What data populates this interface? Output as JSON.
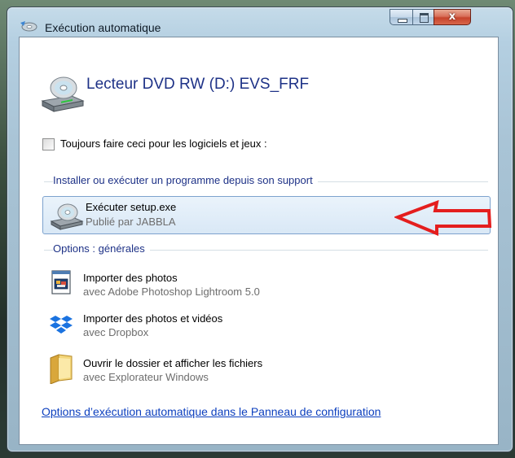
{
  "window": {
    "title": "Exécution automatique",
    "close_glyph": "x"
  },
  "device": {
    "title": "Lecteur DVD RW (D:) EVS_FRF",
    "icon": "dvd-drive-icon"
  },
  "always_option": {
    "label": "Toujours faire ceci pour les logiciels et jeux :",
    "checked": false
  },
  "groups": [
    {
      "header": "Installer ou exécuter un programme depuis son support",
      "items": [
        {
          "title": "Exécuter setup.exe",
          "subtitle": "Publié par JABBLA",
          "icon": "setup-disc-icon",
          "selected": true
        }
      ]
    },
    {
      "header": "Options : générales",
      "items": [
        {
          "title": "Importer des photos",
          "subtitle": "avec Adobe Photoshop Lightroom 5.0",
          "icon": "lightroom-import-icon"
        },
        {
          "title": "Importer des photos et vidéos",
          "subtitle": "avec Dropbox",
          "icon": "dropbox-icon"
        },
        {
          "title": "Ouvrir le dossier et afficher les fichiers",
          "subtitle": "avec Explorateur Windows",
          "icon": "folder-icon"
        }
      ]
    }
  ],
  "control_panel_link": "Options d’exécution automatique dans le Panneau de configuration",
  "annotation_color": "#e41e1e",
  "accent_color": "#1e3287"
}
